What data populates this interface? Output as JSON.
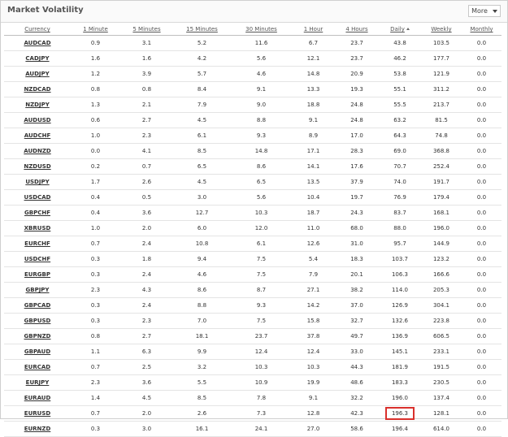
{
  "widget": {
    "title": "Market Volatility",
    "more_label": "More",
    "more_icon": "caret-down-icon"
  },
  "columns": [
    "Currency",
    "1 Minute",
    "5 Minutes",
    "15 Minutes",
    "30 Minutes",
    "1 Hour",
    "4 Hours",
    "Daily",
    "Weekly",
    "Monthly"
  ],
  "sorted_column": "Daily",
  "sort_direction": "ascending",
  "highlight_color": "#d9302c",
  "rows": [
    [
      "AUDCAD",
      "0.9",
      "3.1",
      "5.2",
      "11.6",
      "6.7",
      "23.7",
      "43.8",
      "103.5",
      "0.0"
    ],
    [
      "CADJPY",
      "1.6",
      "1.6",
      "4.2",
      "5.6",
      "12.1",
      "23.7",
      "46.2",
      "177.7",
      "0.0"
    ],
    [
      "AUDJPY",
      "1.2",
      "3.9",
      "5.7",
      "4.6",
      "14.8",
      "20.9",
      "53.8",
      "121.9",
      "0.0"
    ],
    [
      "NZDCAD",
      "0.8",
      "0.8",
      "8.4",
      "9.1",
      "13.3",
      "19.3",
      "55.1",
      "311.2",
      "0.0"
    ],
    [
      "NZDJPY",
      "1.3",
      "2.1",
      "7.9",
      "9.0",
      "18.8",
      "24.8",
      "55.5",
      "213.7",
      "0.0"
    ],
    [
      "AUDUSD",
      "0.6",
      "2.7",
      "4.5",
      "8.8",
      "9.1",
      "24.8",
      "63.2",
      "81.5",
      "0.0"
    ],
    [
      "AUDCHF",
      "1.0",
      "2.3",
      "6.1",
      "9.3",
      "8.9",
      "17.0",
      "64.3",
      "74.8",
      "0.0"
    ],
    [
      "AUDNZD",
      "0.0",
      "4.1",
      "8.5",
      "14.8",
      "17.1",
      "28.3",
      "69.0",
      "368.8",
      "0.0"
    ],
    [
      "NZDUSD",
      "0.2",
      "0.7",
      "6.5",
      "8.6",
      "14.1",
      "17.6",
      "70.7",
      "252.4",
      "0.0"
    ],
    [
      "USDJPY",
      "1.7",
      "2.6",
      "4.5",
      "6.5",
      "13.5",
      "37.9",
      "74.0",
      "191.7",
      "0.0"
    ],
    [
      "USDCAD",
      "0.4",
      "0.5",
      "3.0",
      "5.6",
      "10.4",
      "19.7",
      "76.9",
      "179.4",
      "0.0"
    ],
    [
      "GBPCHF",
      "0.4",
      "3.6",
      "12.7",
      "10.3",
      "18.7",
      "24.3",
      "83.7",
      "168.1",
      "0.0"
    ],
    [
      "XBRUSD",
      "1.0",
      "2.0",
      "6.0",
      "12.0",
      "11.0",
      "68.0",
      "88.0",
      "196.0",
      "0.0"
    ],
    [
      "EURCHF",
      "0.7",
      "2.4",
      "10.8",
      "6.1",
      "12.6",
      "31.0",
      "95.7",
      "144.9",
      "0.0"
    ],
    [
      "USDCHF",
      "0.3",
      "1.8",
      "9.4",
      "7.5",
      "5.4",
      "18.3",
      "103.7",
      "123.2",
      "0.0"
    ],
    [
      "EURGBP",
      "0.3",
      "2.4",
      "4.6",
      "7.5",
      "7.9",
      "20.1",
      "106.3",
      "166.6",
      "0.0"
    ],
    [
      "GBPJPY",
      "2.3",
      "4.3",
      "8.6",
      "8.7",
      "27.1",
      "38.2",
      "114.0",
      "205.3",
      "0.0"
    ],
    [
      "GBPCAD",
      "0.3",
      "2.4",
      "8.8",
      "9.3",
      "14.2",
      "37.0",
      "126.9",
      "304.1",
      "0.0"
    ],
    [
      "GBPUSD",
      "0.3",
      "2.3",
      "7.0",
      "7.5",
      "15.8",
      "32.7",
      "132.6",
      "223.8",
      "0.0"
    ],
    [
      "GBPNZD",
      "0.8",
      "2.7",
      "18.1",
      "23.7",
      "37.8",
      "49.7",
      "136.9",
      "606.5",
      "0.0"
    ],
    [
      "GBPAUD",
      "1.1",
      "6.3",
      "9.9",
      "12.4",
      "12.4",
      "33.0",
      "145.1",
      "233.1",
      "0.0"
    ],
    [
      "EURCAD",
      "0.7",
      "2.5",
      "3.2",
      "10.3",
      "10.3",
      "44.3",
      "181.9",
      "191.5",
      "0.0"
    ],
    [
      "EURJPY",
      "2.3",
      "3.6",
      "5.5",
      "10.9",
      "19.9",
      "48.6",
      "183.3",
      "230.5",
      "0.0"
    ],
    [
      "EURAUD",
      "1.4",
      "4.5",
      "8.5",
      "7.8",
      "9.1",
      "32.2",
      "196.0",
      "137.4",
      "0.0"
    ],
    [
      "EURUSD",
      "0.7",
      "2.0",
      "2.6",
      "7.3",
      "12.8",
      "42.3",
      "196.3",
      "128.1",
      "0.0"
    ],
    [
      "EURNZD",
      "0.3",
      "3.0",
      "16.1",
      "24.1",
      "27.0",
      "58.6",
      "196.4",
      "614.0",
      "0.0"
    ]
  ],
  "highlighted_cell": {
    "row": 24,
    "column": 7
  }
}
